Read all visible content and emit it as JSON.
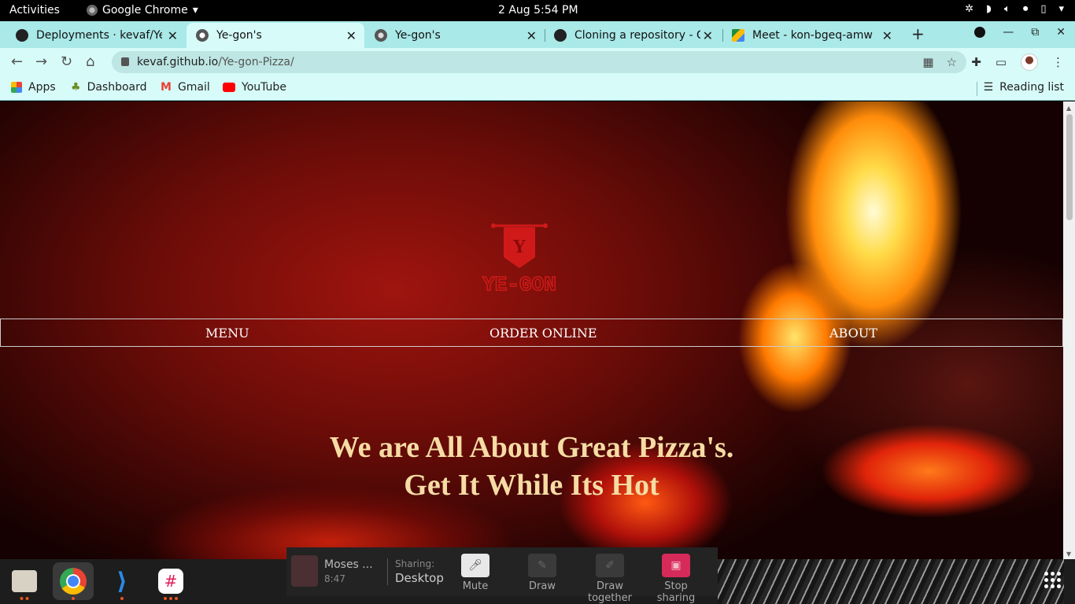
{
  "system": {
    "activities": "Activities",
    "app_name": "Google Chrome",
    "clock": "2 Aug  5:54 PM"
  },
  "tabs": [
    {
      "title": "Deployments · kevaf/Ye-gon",
      "favicon": "github-icon",
      "active": false
    },
    {
      "title": "Ye-gon's",
      "favicon": "globe-icon",
      "active": true
    },
    {
      "title": "Ye-gon's",
      "favicon": "globe-icon",
      "active": false
    },
    {
      "title": "Cloning a repository - Git",
      "favicon": "github-icon",
      "active": false
    },
    {
      "title": "Meet - kon-bgeq-amw",
      "favicon": "meet-icon",
      "active": false
    }
  ],
  "omnibox": {
    "host": "kevaf.github.io",
    "path": "/Ye-gon-Pizza/"
  },
  "bookmarks": {
    "items": [
      "Apps",
      "Dashboard",
      "Gmail",
      "YouTube"
    ],
    "reading_list": "Reading list"
  },
  "page": {
    "logo_text": "YE-GON",
    "logo_letter": "Y",
    "nav": [
      "MENU",
      "ORDER ONLINE",
      "ABOUT"
    ],
    "hero_line1": "We are All About Great Pizza's.",
    "hero_line2": "Get It While Its Hot"
  },
  "meet": {
    "person_name": "Moses ...",
    "person_time": "8:47",
    "sharing_label": "Sharing:",
    "sharing_value": "Desktop",
    "buttons": [
      "Mute",
      "Draw",
      "Draw together",
      "Stop sharing"
    ]
  },
  "colors": {
    "tab_strip": "#a9e9e8",
    "toolbar": "#d6fbf9",
    "hero_text": "#f6dca4",
    "logo_red": "#d01a1a",
    "stop_sharing": "#d62a5a"
  }
}
